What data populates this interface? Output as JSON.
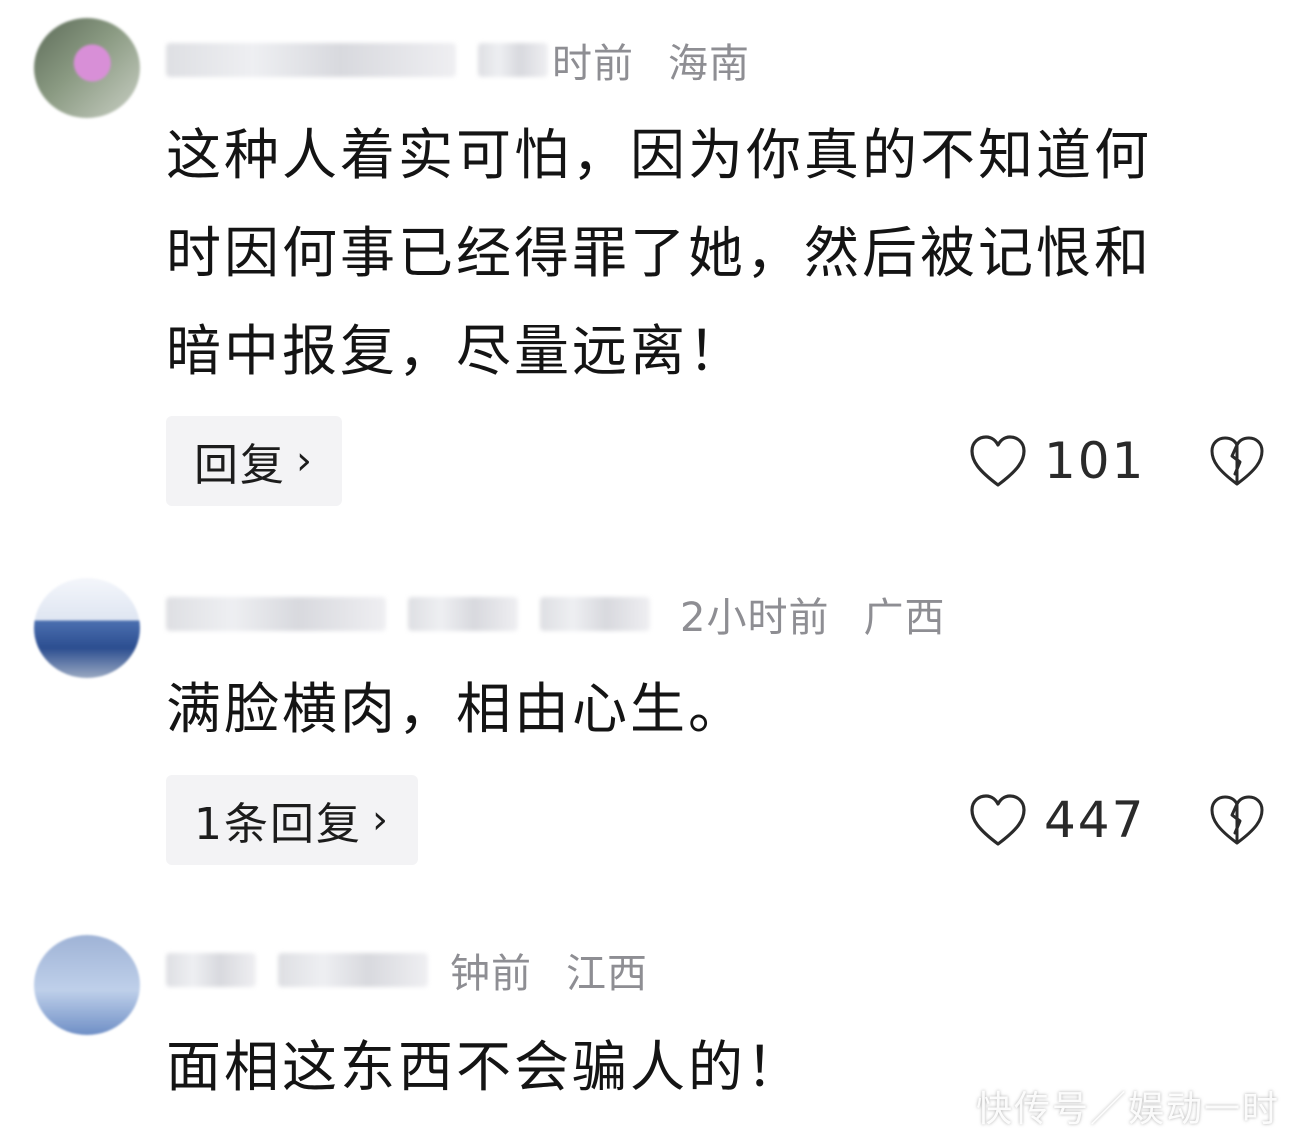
{
  "comments": [
    {
      "meta_time": "时前",
      "meta_location": "海南",
      "text": "这种人着实可怕，因为你真的不知道何\n时因何事已经得罪了她，然后被记恨和\n暗中报复，尽量远离！",
      "reply_label": "回复",
      "likes": "101",
      "avatar_icon": "blurred-user-avatar",
      "like_icon": "heart-outline-icon",
      "dislike_icon": "broken-heart-icon"
    },
    {
      "meta_time": "2小时前",
      "meta_location": "广西",
      "text": "满脸横肉，相由心生。",
      "reply_label": "1条回复",
      "likes": "447",
      "avatar_icon": "blurred-user-avatar",
      "like_icon": "heart-outline-icon",
      "dislike_icon": "broken-heart-icon"
    },
    {
      "meta_time": "钟前",
      "meta_location": "江西",
      "text": "面相这东西不会骗人的！",
      "avatar_icon": "blurred-user-avatar"
    }
  ],
  "watermark": "快传号／娱动一时",
  "colors": {
    "background": "#ffffff",
    "meta_text": "#8e8e93",
    "reply_button_bg": "#f3f3f5"
  }
}
